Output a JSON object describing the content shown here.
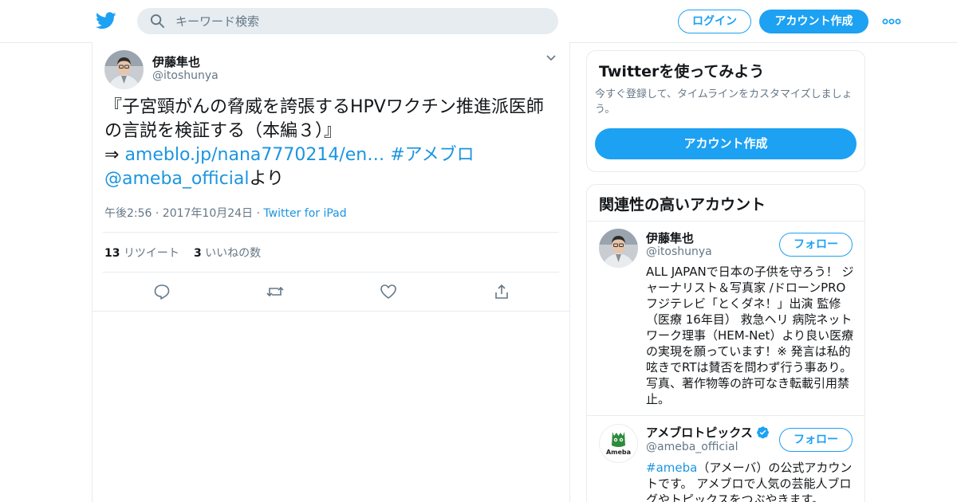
{
  "header": {
    "search_placeholder": "キーワード検索",
    "login_label": "ログイン",
    "signup_label": "アカウント作成"
  },
  "tweet": {
    "author_name": "伊藤隼也",
    "author_handle": "@itoshunya",
    "text_part1": "『子宮頸がんの脅威を誇張するHPVワクチン推進派医師の言説を検証する（本編３）』",
    "arrow": "⇒ ",
    "link_url": "ameblo.jp/nana7770214/en…",
    "hashtag": "#アメブロ",
    "mention": "@ameba_official",
    "text_suffix": "より",
    "time": "午後2:56 · 2017年10月24日",
    "meta_sep": " · ",
    "client": "Twitter for iPad",
    "retweet_count": "13",
    "retweet_label": "リツイート",
    "like_count": "3",
    "like_label": "いいねの数"
  },
  "signup_card": {
    "title": "Twitterを使ってみよう",
    "description": "今すぐ登録して、タイムラインをカスタマイズしましょう。",
    "button_label": "アカウント作成"
  },
  "related": {
    "title": "関連性の高いアカウント",
    "accounts": [
      {
        "name": "伊藤隼也",
        "handle": "@itoshunya",
        "follow_label": "フォロー",
        "bio": "ALL JAPANで日本の子供を守ろう！ ジャーナリスト＆写真家 /ドローンPRO フジテレビ「とくダネ！」出演 監修（医療 16年目） 救急ヘリ 病院ネットワーク理事（HEM-Net）より良い医療の実現を願っています！※ 発言は私的呟きでRTは賛否を問わず行う事あり。写真、著作物等の許可なき転載引用禁止。"
      },
      {
        "name": "アメブロトピックス",
        "handle": "@ameba_official",
        "follow_label": "フォロー",
        "bio_hashtag": "#ameba",
        "bio": "（アメーバ）の公式アカウントです。 アメブロで人気の芸能人ブログやトピックスをつぶやきます。",
        "avatar_text": "Ameba",
        "verified": true
      }
    ]
  },
  "colors": {
    "brand": "#1da1f2",
    "link": "#1b95e0",
    "secondary_text": "#657786",
    "border": "#e6ecf0",
    "ameba_green": "#2d8c3c"
  }
}
